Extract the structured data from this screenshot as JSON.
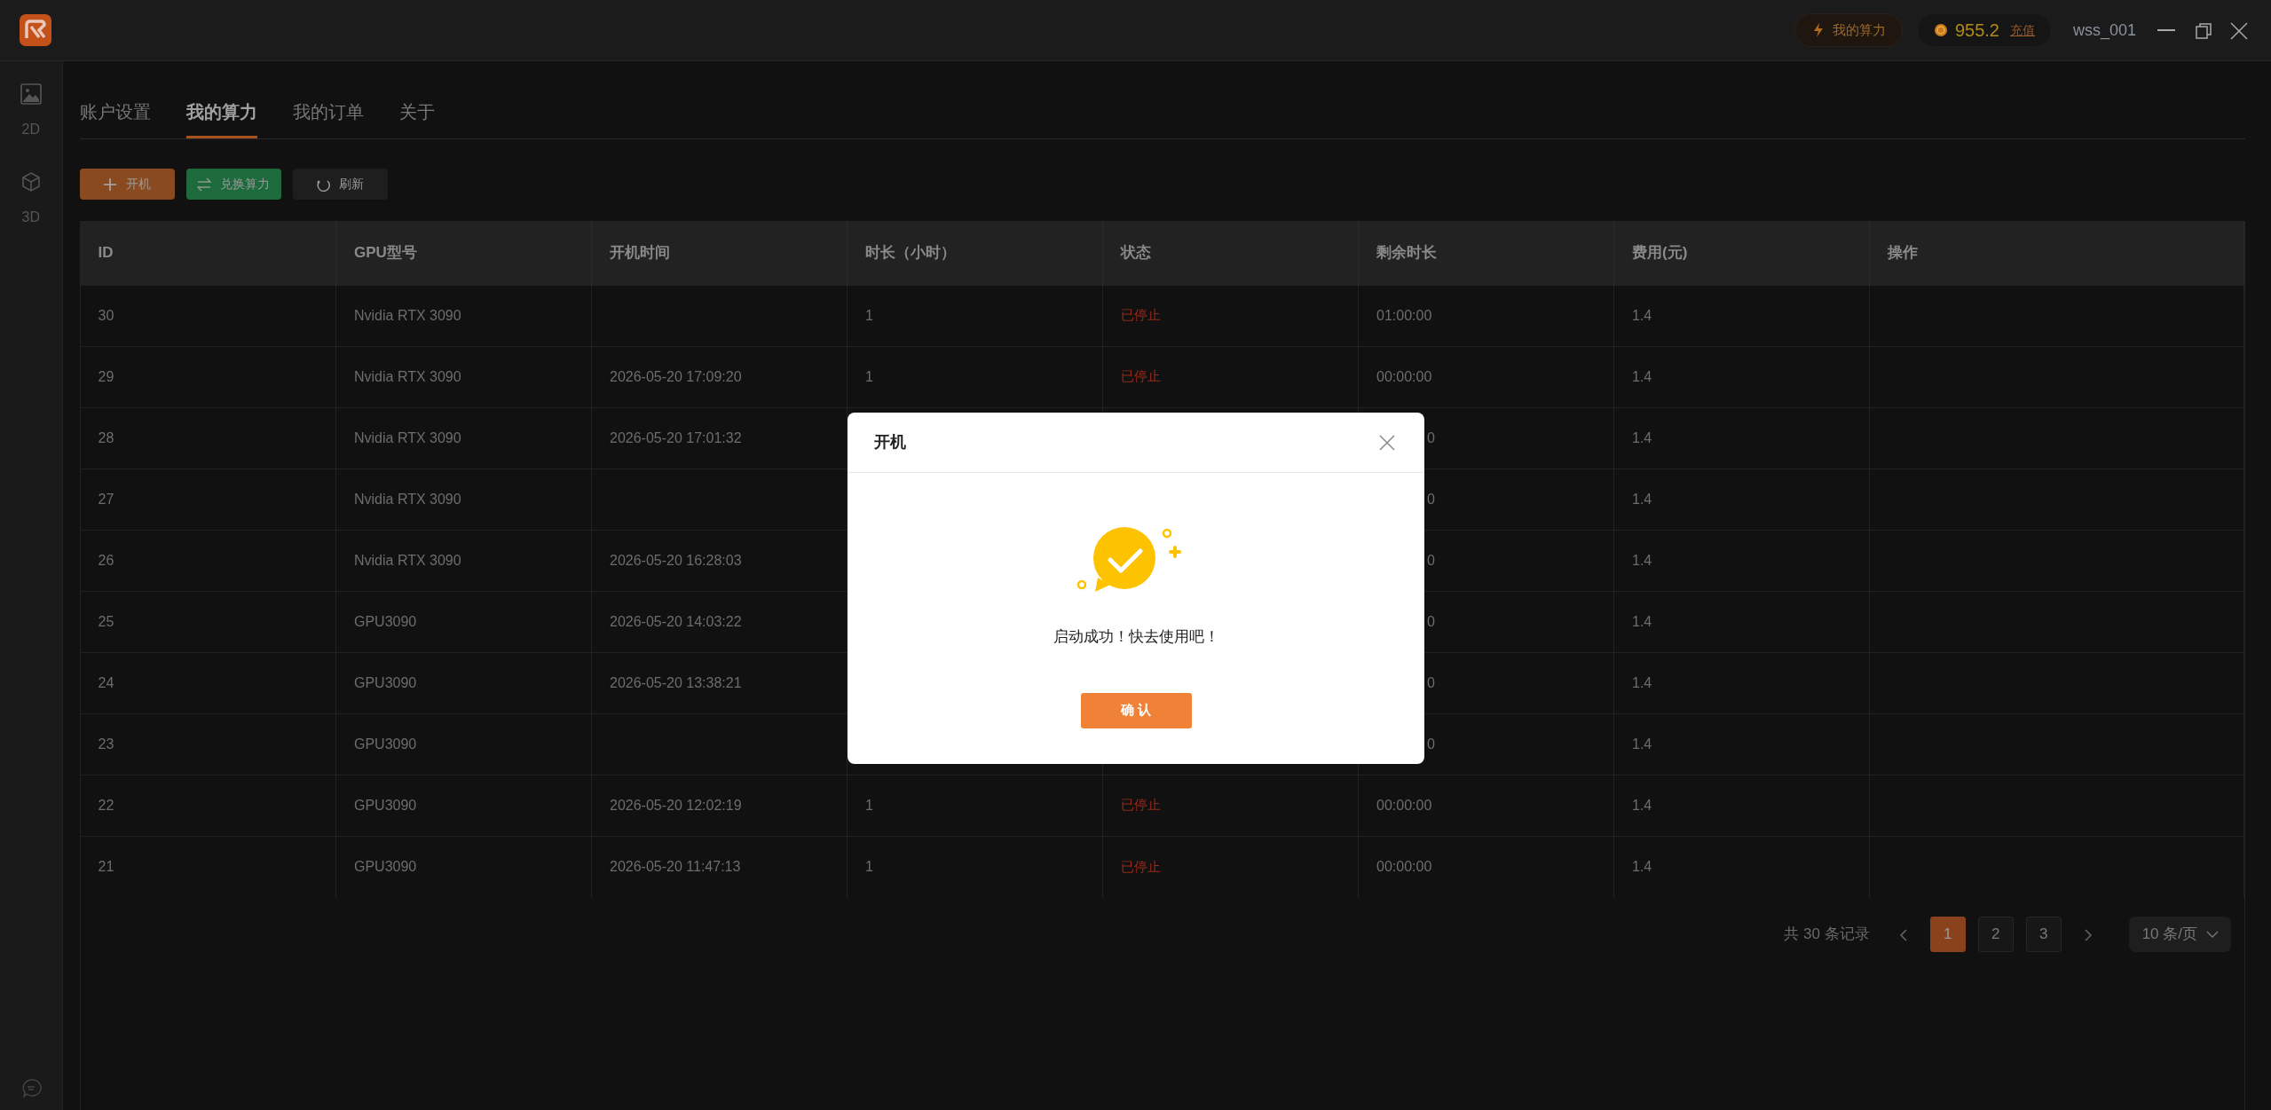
{
  "titlebar": {
    "power_button": "我的算力",
    "balance": "955.2",
    "recharge": "充值",
    "username": "wss_001"
  },
  "sidebar": {
    "items": [
      {
        "label": "2D",
        "kind": "image"
      },
      {
        "label": "3D",
        "kind": "cube"
      }
    ]
  },
  "tabs": [
    {
      "label": "账户设置",
      "selected": false
    },
    {
      "label": "我的算力",
      "selected": true
    },
    {
      "label": "我的订单",
      "selected": false
    },
    {
      "label": "关于",
      "selected": false
    }
  ],
  "toolbar": {
    "buttons": [
      {
        "label": "开机",
        "kind": "add"
      },
      {
        "label": "兑换算力",
        "kind": "exchange"
      },
      {
        "label": "刷新",
        "kind": "refresh"
      }
    ]
  },
  "table": {
    "columns": [
      {
        "label": "ID"
      },
      {
        "label": "GPU型号"
      },
      {
        "label": "开机时间"
      },
      {
        "label": "时长（小时）"
      },
      {
        "label": "状态",
        "kind": "status"
      },
      {
        "label": "剩余时长"
      },
      {
        "label": "费用(元)"
      },
      {
        "label": "操作"
      }
    ],
    "rows": [
      {
        "cells": [
          "30",
          "Nvidia RTX 3090",
          null,
          "1",
          "已停止",
          "01:00:00",
          "1.4",
          null
        ]
      },
      {
        "cells": [
          "29",
          "Nvidia RTX 3090",
          "2026-05-20 17:09:20",
          "1",
          "已停止",
          "00:00:00",
          "1.4",
          null
        ]
      },
      {
        "cells": [
          "28",
          "Nvidia RTX 3090",
          "2026-05-20 17:01:32",
          null,
          null,
          {
            "text": "0",
            "clipped": true
          },
          "1.4",
          null
        ]
      },
      {
        "cells": [
          "27",
          "Nvidia RTX 3090",
          null,
          null,
          null,
          {
            "text": "0",
            "clipped": true
          },
          "1.4",
          null
        ]
      },
      {
        "cells": [
          "26",
          "Nvidia RTX 3090",
          "2026-05-20 16:28:03",
          null,
          null,
          {
            "text": "0",
            "clipped": true
          },
          "1.4",
          null
        ]
      },
      {
        "cells": [
          "25",
          "GPU3090",
          "2026-05-20 14:03:22",
          null,
          null,
          {
            "text": "0",
            "clipped": true
          },
          "1.4",
          null
        ]
      },
      {
        "cells": [
          "24",
          "GPU3090",
          "2026-05-20 13:38:21",
          null,
          null,
          {
            "text": "0",
            "clipped": true
          },
          "1.4",
          null
        ]
      },
      {
        "cells": [
          "23",
          "GPU3090",
          null,
          null,
          null,
          {
            "text": "0",
            "clipped": true
          },
          "1.4",
          null
        ]
      },
      {
        "cells": [
          "22",
          "GPU3090",
          "2026-05-20 12:02:19",
          "1",
          "已停止",
          "00:00:00",
          "1.4",
          null
        ]
      },
      {
        "cells": [
          "21",
          "GPU3090",
          "2026-05-20 11:47:13",
          "1",
          "已停止",
          "00:00:00",
          "1.4",
          null
        ]
      }
    ]
  },
  "pagination": {
    "summary": "共 30 条记录",
    "pages": [
      {
        "label": "1",
        "selected": true
      },
      {
        "label": "2",
        "selected": false
      },
      {
        "label": "3",
        "selected": false
      }
    ],
    "page_size": "10 条/页"
  },
  "dialog": {
    "title": "开机",
    "message": "启动成功！快去使用吧！",
    "confirm": "确 认"
  }
}
